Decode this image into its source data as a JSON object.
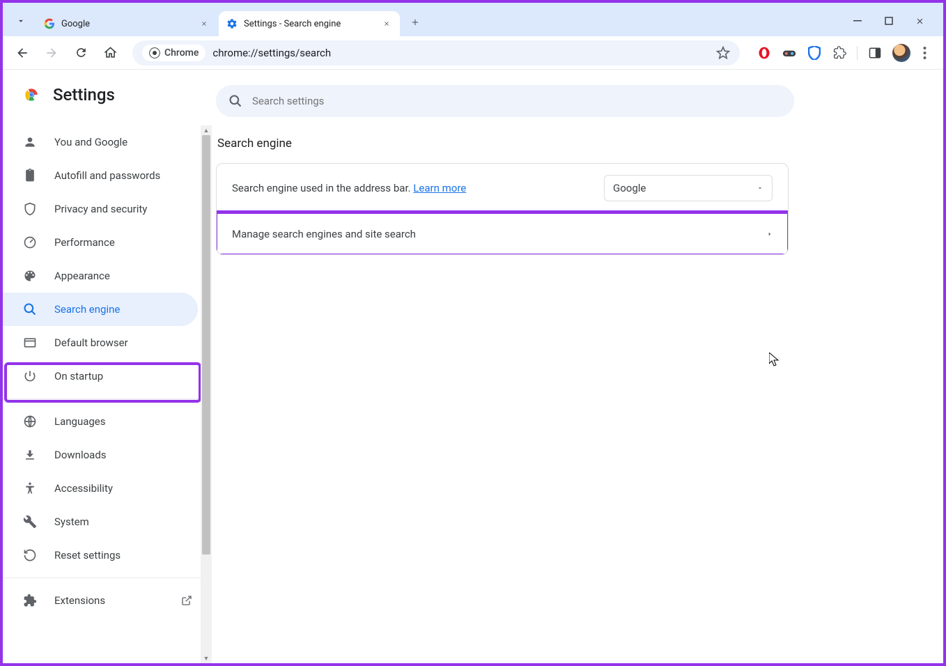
{
  "tabs": [
    {
      "title": "Google"
    },
    {
      "title": "Settings - Search engine"
    }
  ],
  "omnibox": {
    "chip": "Chrome",
    "url": "chrome://settings/search"
  },
  "settings_header": "Settings",
  "search_placeholder": "Search settings",
  "sidebar": {
    "items": [
      {
        "label": "You and Google"
      },
      {
        "label": "Autofill and passwords"
      },
      {
        "label": "Privacy and security"
      },
      {
        "label": "Performance"
      },
      {
        "label": "Appearance"
      },
      {
        "label": "Search engine"
      },
      {
        "label": "Default browser"
      },
      {
        "label": "On startup"
      }
    ],
    "items2": [
      {
        "label": "Languages"
      },
      {
        "label": "Downloads"
      },
      {
        "label": "Accessibility"
      },
      {
        "label": "System"
      },
      {
        "label": "Reset settings"
      }
    ],
    "items3": [
      {
        "label": "Extensions"
      }
    ]
  },
  "main": {
    "section_title": "Search engine",
    "row1_text": "Search engine used in the address bar.",
    "row1_learn": "Learn more",
    "dropdown_value": "Google",
    "row2_text": "Manage search engines and site search"
  }
}
